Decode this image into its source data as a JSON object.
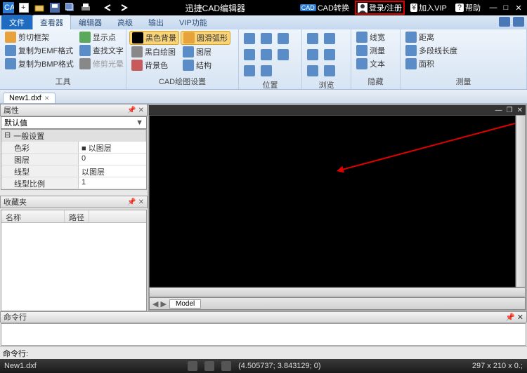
{
  "app": {
    "title": "迅捷CAD编辑器"
  },
  "titlebar": {
    "cad_convert": "CAD转换",
    "login": "登录/注册",
    "vip": "加入VIP",
    "help": "帮助"
  },
  "ribbon_tabs": {
    "file": "文件",
    "viewer": "查看器",
    "editor": "编辑器",
    "advanced": "高级",
    "output": "输出",
    "vip": "VIP功能"
  },
  "ribbon": {
    "group_tools": {
      "label": "工具",
      "cut_frame": "剪切框架",
      "copy_emf": "复制为EMF格式",
      "copy_bmp": "复制为BMP格式",
      "show_points": "显示点",
      "find_text": "查找文字",
      "glare": "修剪光晕"
    },
    "group_cad": {
      "label": "CAD绘图设置",
      "black_bg": "黑色背景",
      "arc_circle": "圆滑弧形",
      "bw_draw": "黑白绘图",
      "layers": "图层",
      "bg_color": "背景色",
      "structure": "结构"
    },
    "group_pos": {
      "label": "位置"
    },
    "group_browse": {
      "label": "浏览"
    },
    "group_hide": {
      "label": "隐藏",
      "lw": "线宽",
      "measure": "测量",
      "text": "文本"
    },
    "group_measure": {
      "label": "测量",
      "distance": "距离",
      "multiline": "多段线长度",
      "area": "面积"
    }
  },
  "doc_tab": {
    "name": "New1.dxf"
  },
  "panels": {
    "props_title": "属性",
    "default": "默认值",
    "general": "一般设置",
    "rows": {
      "color_k": "色彩",
      "color_v": "■ 以图层",
      "layer_k": "图层",
      "layer_v": "0",
      "ltype_k": "线型",
      "ltype_v": "以图层",
      "lscale_k": "线型比例",
      "lscale_v": "1"
    },
    "fav_title": "收藏夹",
    "fav_name": "名称",
    "fav_path": "路径"
  },
  "viewport": {
    "model_tab": "Model"
  },
  "cmd": {
    "title": "命令行",
    "prompt": "命令行:"
  },
  "status": {
    "file": "New1.dxf",
    "coords": "(4.505737; 3.843129; 0)",
    "paper": "297 x 210 x 0.;"
  }
}
